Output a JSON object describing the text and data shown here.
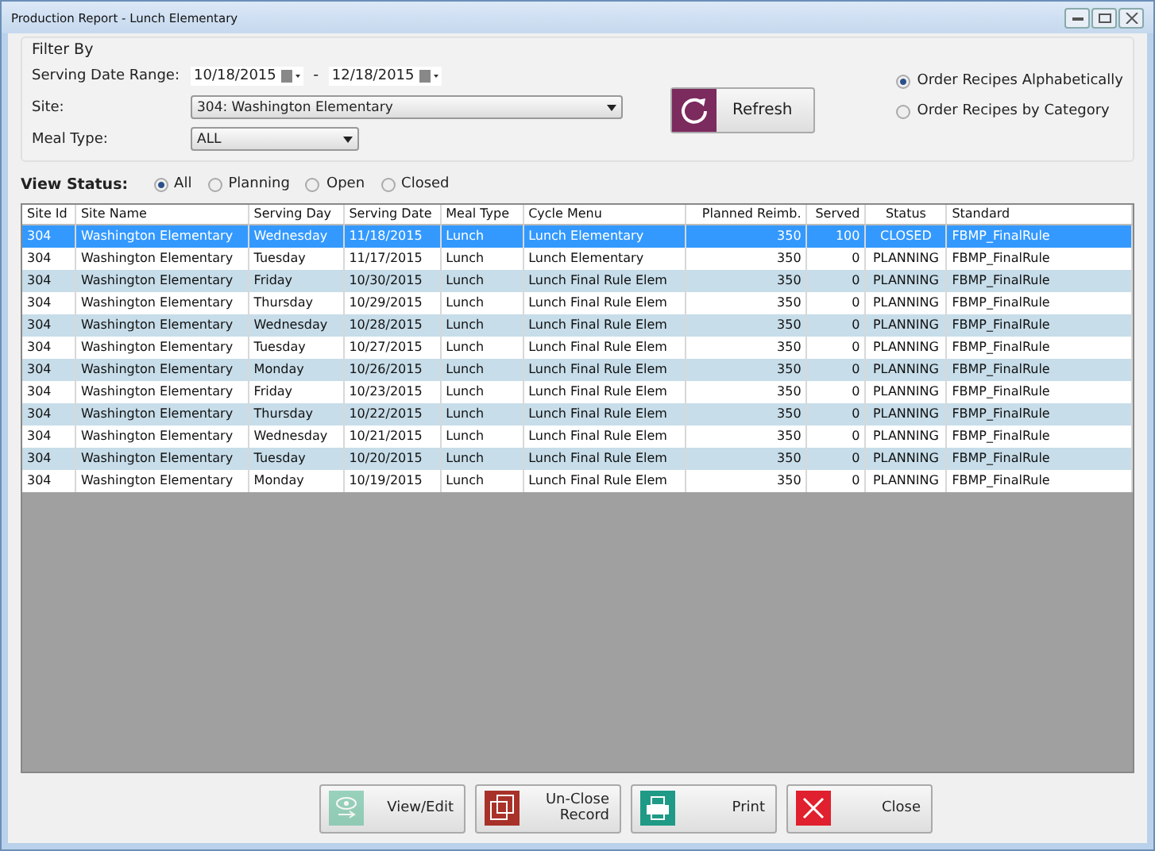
{
  "window": {
    "title": "Production Report - Lunch Elementary"
  },
  "filter": {
    "title": "Filter By",
    "date_label": "Serving Date Range:",
    "date_from": "10/18/2015",
    "separator": "-",
    "date_to": "12/18/2015",
    "site_label": "Site:",
    "site": "304:  Washington Elementary",
    "meal_label": "Meal Type:",
    "meal": "ALL",
    "refresh": "Refresh",
    "order_options": [
      {
        "label": "Order Recipes Alphabetically",
        "selected": true
      },
      {
        "label": "Order Recipes by Category",
        "selected": false
      }
    ]
  },
  "view_status": {
    "label": "View Status:",
    "options": [
      {
        "label": "All",
        "selected": true
      },
      {
        "label": "Planning",
        "selected": false
      },
      {
        "label": "Open",
        "selected": false
      },
      {
        "label": "Closed",
        "selected": false
      }
    ]
  },
  "table": {
    "columns": [
      "Site Id",
      "Site Name",
      "Serving Day",
      "Serving Date",
      "Meal Type",
      "Cycle Menu",
      "Planned Reimb.",
      "Served",
      "Status",
      "Standard"
    ],
    "rows": [
      {
        "selected": true,
        "cells": [
          "304",
          "Washington Elementary",
          "Wednesday",
          "11/18/2015",
          "Lunch",
          "Lunch Elementary",
          "350",
          "100",
          "CLOSED",
          "FBMP_FinalRule"
        ]
      },
      {
        "selected": false,
        "cells": [
          "304",
          "Washington Elementary",
          "Tuesday",
          "11/17/2015",
          "Lunch",
          "Lunch Elementary",
          "350",
          "0",
          "PLANNING",
          "FBMP_FinalRule"
        ]
      },
      {
        "selected": false,
        "cells": [
          "304",
          "Washington Elementary",
          "Friday",
          "10/30/2015",
          "Lunch",
          "Lunch Final Rule Elem",
          "350",
          "0",
          "PLANNING",
          "FBMP_FinalRule"
        ]
      },
      {
        "selected": false,
        "cells": [
          "304",
          "Washington Elementary",
          "Thursday",
          "10/29/2015",
          "Lunch",
          "Lunch Final Rule Elem",
          "350",
          "0",
          "PLANNING",
          "FBMP_FinalRule"
        ]
      },
      {
        "selected": false,
        "cells": [
          "304",
          "Washington Elementary",
          "Wednesday",
          "10/28/2015",
          "Lunch",
          "Lunch Final Rule Elem",
          "350",
          "0",
          "PLANNING",
          "FBMP_FinalRule"
        ]
      },
      {
        "selected": false,
        "cells": [
          "304",
          "Washington Elementary",
          "Tuesday",
          "10/27/2015",
          "Lunch",
          "Lunch Final Rule Elem",
          "350",
          "0",
          "PLANNING",
          "FBMP_FinalRule"
        ]
      },
      {
        "selected": false,
        "cells": [
          "304",
          "Washington Elementary",
          "Monday",
          "10/26/2015",
          "Lunch",
          "Lunch Final Rule Elem",
          "350",
          "0",
          "PLANNING",
          "FBMP_FinalRule"
        ]
      },
      {
        "selected": false,
        "cells": [
          "304",
          "Washington Elementary",
          "Friday",
          "10/23/2015",
          "Lunch",
          "Lunch Final Rule Elem",
          "350",
          "0",
          "PLANNING",
          "FBMP_FinalRule"
        ]
      },
      {
        "selected": false,
        "cells": [
          "304",
          "Washington Elementary",
          "Thursday",
          "10/22/2015",
          "Lunch",
          "Lunch Final Rule Elem",
          "350",
          "0",
          "PLANNING",
          "FBMP_FinalRule"
        ]
      },
      {
        "selected": false,
        "cells": [
          "304",
          "Washington Elementary",
          "Wednesday",
          "10/21/2015",
          "Lunch",
          "Lunch Final Rule Elem",
          "350",
          "0",
          "PLANNING",
          "FBMP_FinalRule"
        ]
      },
      {
        "selected": false,
        "cells": [
          "304",
          "Washington Elementary",
          "Tuesday",
          "10/20/2015",
          "Lunch",
          "Lunch Final Rule Elem",
          "350",
          "0",
          "PLANNING",
          "FBMP_FinalRule"
        ]
      },
      {
        "selected": false,
        "cells": [
          "304",
          "Washington Elementary",
          "Monday",
          "10/19/2015",
          "Lunch",
          "Lunch Final Rule Elem",
          "350",
          "0",
          "PLANNING",
          "FBMP_FinalRule"
        ]
      }
    ]
  },
  "buttons": [
    {
      "kind": "view",
      "label": "View/Edit",
      "disabled": true
    },
    {
      "kind": "unclose",
      "label": "Un-Close Record",
      "disabled": false
    },
    {
      "kind": "print",
      "label": "Print",
      "disabled": false
    },
    {
      "kind": "close",
      "label": "Close",
      "disabled": false
    }
  ]
}
